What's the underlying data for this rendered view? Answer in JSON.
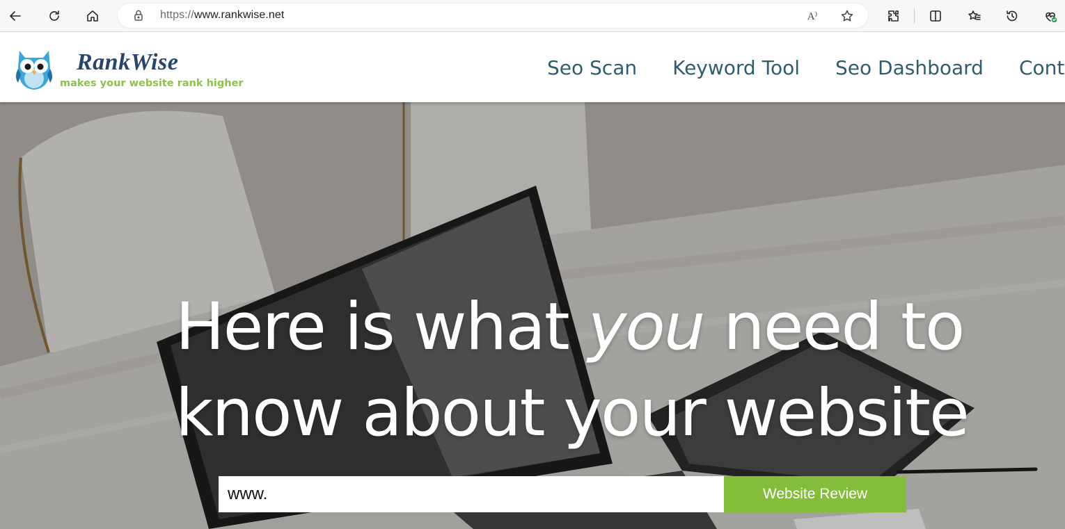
{
  "browser": {
    "url_scheme": "https://",
    "url_host": "www.rankwise.net",
    "read_aloud_label": "A⁾",
    "icons": [
      "back-icon",
      "refresh-icon",
      "home-icon",
      "lock-icon",
      "read-aloud-icon",
      "favorite-star-icon",
      "extensions-icon",
      "split-screen-icon",
      "favorites-icon",
      "history-icon",
      "browser-essentials-icon"
    ]
  },
  "site": {
    "brand_name": "RankWise",
    "tagline": "makes your website rank higher",
    "nav": [
      {
        "label": "Seo Scan"
      },
      {
        "label": "Keyword Tool"
      },
      {
        "label": "Seo Dashboard"
      },
      {
        "label": "Conta"
      }
    ]
  },
  "hero": {
    "title_part1": "Here is what ",
    "title_em": "you",
    "title_part2": " need to",
    "title_line2": "know about your website",
    "input_value": "www.",
    "button_label": "Website Review"
  },
  "colors": {
    "brand_navy": "#27456e",
    "tagline_green": "#8bc34a",
    "nav_teal": "#2e5e6e",
    "button_green": "#84bd3a"
  }
}
